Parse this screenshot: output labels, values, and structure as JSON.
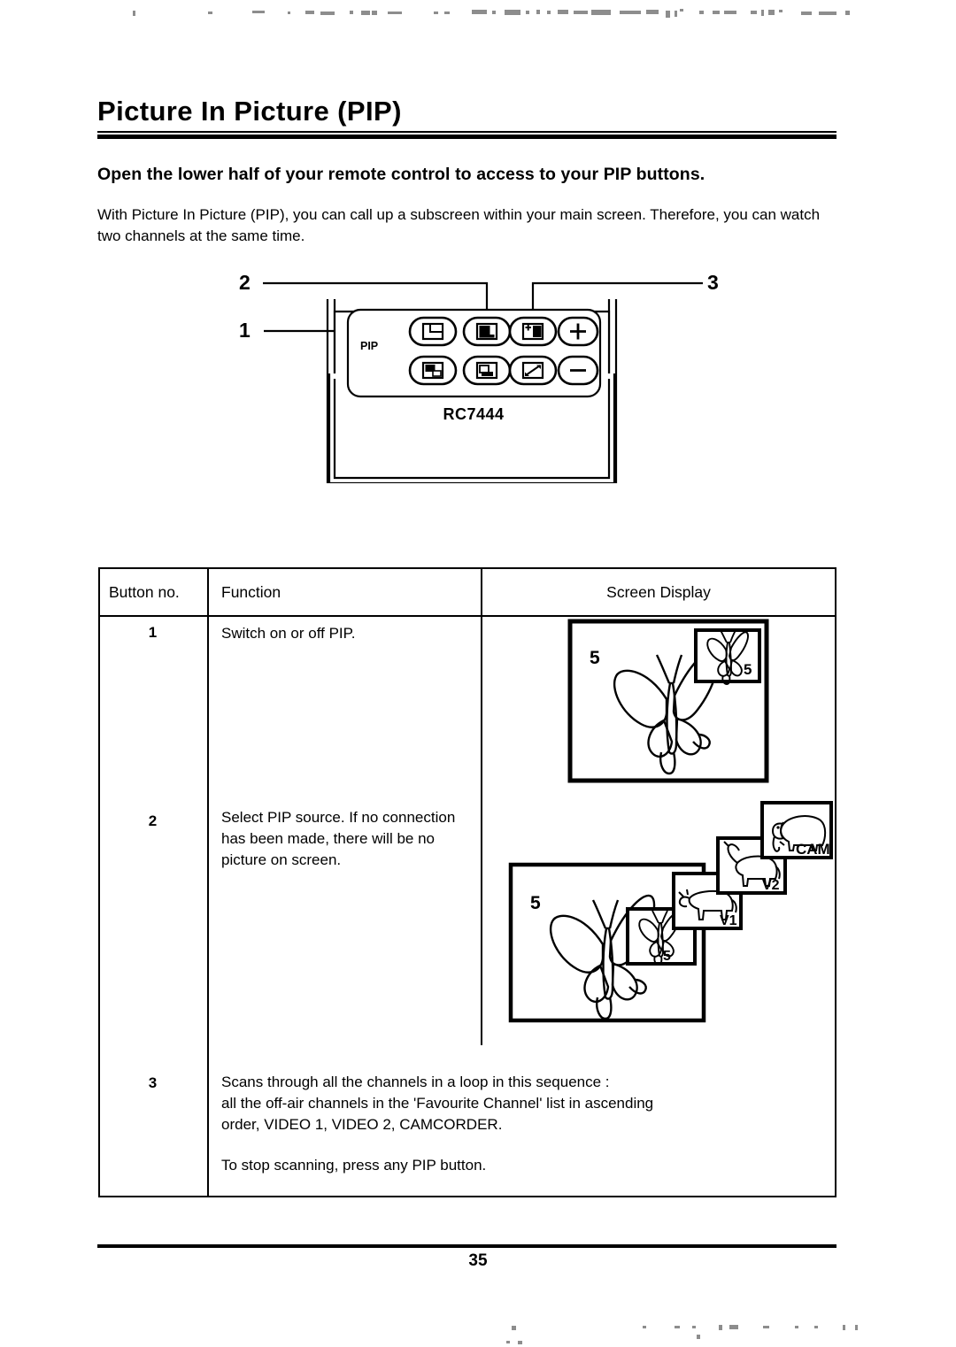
{
  "document": {
    "title": "Picture In Picture (PIP)",
    "subheading": "Open the lower half of your remote control to access to your PIP buttons.",
    "intro": "With Picture In Picture (PIP), you can call up a subscreen within your main screen. Therefore, you can watch two channels at the same time.",
    "page_number": "35"
  },
  "figure": {
    "remote_model": "RC7444",
    "pip_label": "PIP",
    "callouts": [
      {
        "number": "1",
        "target": "pip-on-off-button"
      },
      {
        "number": "2",
        "target": "pip-source-button"
      },
      {
        "number": "3",
        "target": "pip-scan-button"
      }
    ],
    "buttons": {
      "top": [
        "pip-on-off",
        "pip-source",
        "pip-scan",
        "plus"
      ],
      "bottom": [
        "pip-position",
        "pip-swap",
        "pip-size",
        "minus"
      ],
      "plus_label": "+",
      "minus_label": "−"
    }
  },
  "table": {
    "headers": [
      "Button no.",
      "Function",
      "Screen Display"
    ],
    "rows": [
      {
        "button_no": "1",
        "function": "Switch on or off PIP.",
        "screen_display": {
          "type": "single-pip",
          "main_channel": "5",
          "main_image": "butterfly",
          "subscreens": [
            {
              "label": "5",
              "image": "butterfly"
            }
          ]
        }
      },
      {
        "button_no": "2",
        "function": "Select PIP source. If no connection has been made, there will be no picture on screen.",
        "screen_display": {
          "type": "cascade-pip",
          "main_channel": "5",
          "main_image": "butterfly",
          "subscreens": [
            {
              "label": "5",
              "image": "butterfly"
            },
            {
              "label": "V1",
              "image": "cow"
            },
            {
              "label": "V2",
              "image": "goat"
            },
            {
              "label": "CAM",
              "image": "elephant"
            }
          ]
        }
      },
      {
        "button_no": "3",
        "function_line1": "Scans through all the channels in a loop in this sequence :",
        "function_line2": "all the off-air channels in the 'Favourite Channel' list in ascending",
        "function_line3": "order, VIDEO 1, VIDEO 2, CAMCORDER.",
        "function_line4": "To stop scanning, press any PIP button.",
        "screen_display": null
      }
    ]
  }
}
